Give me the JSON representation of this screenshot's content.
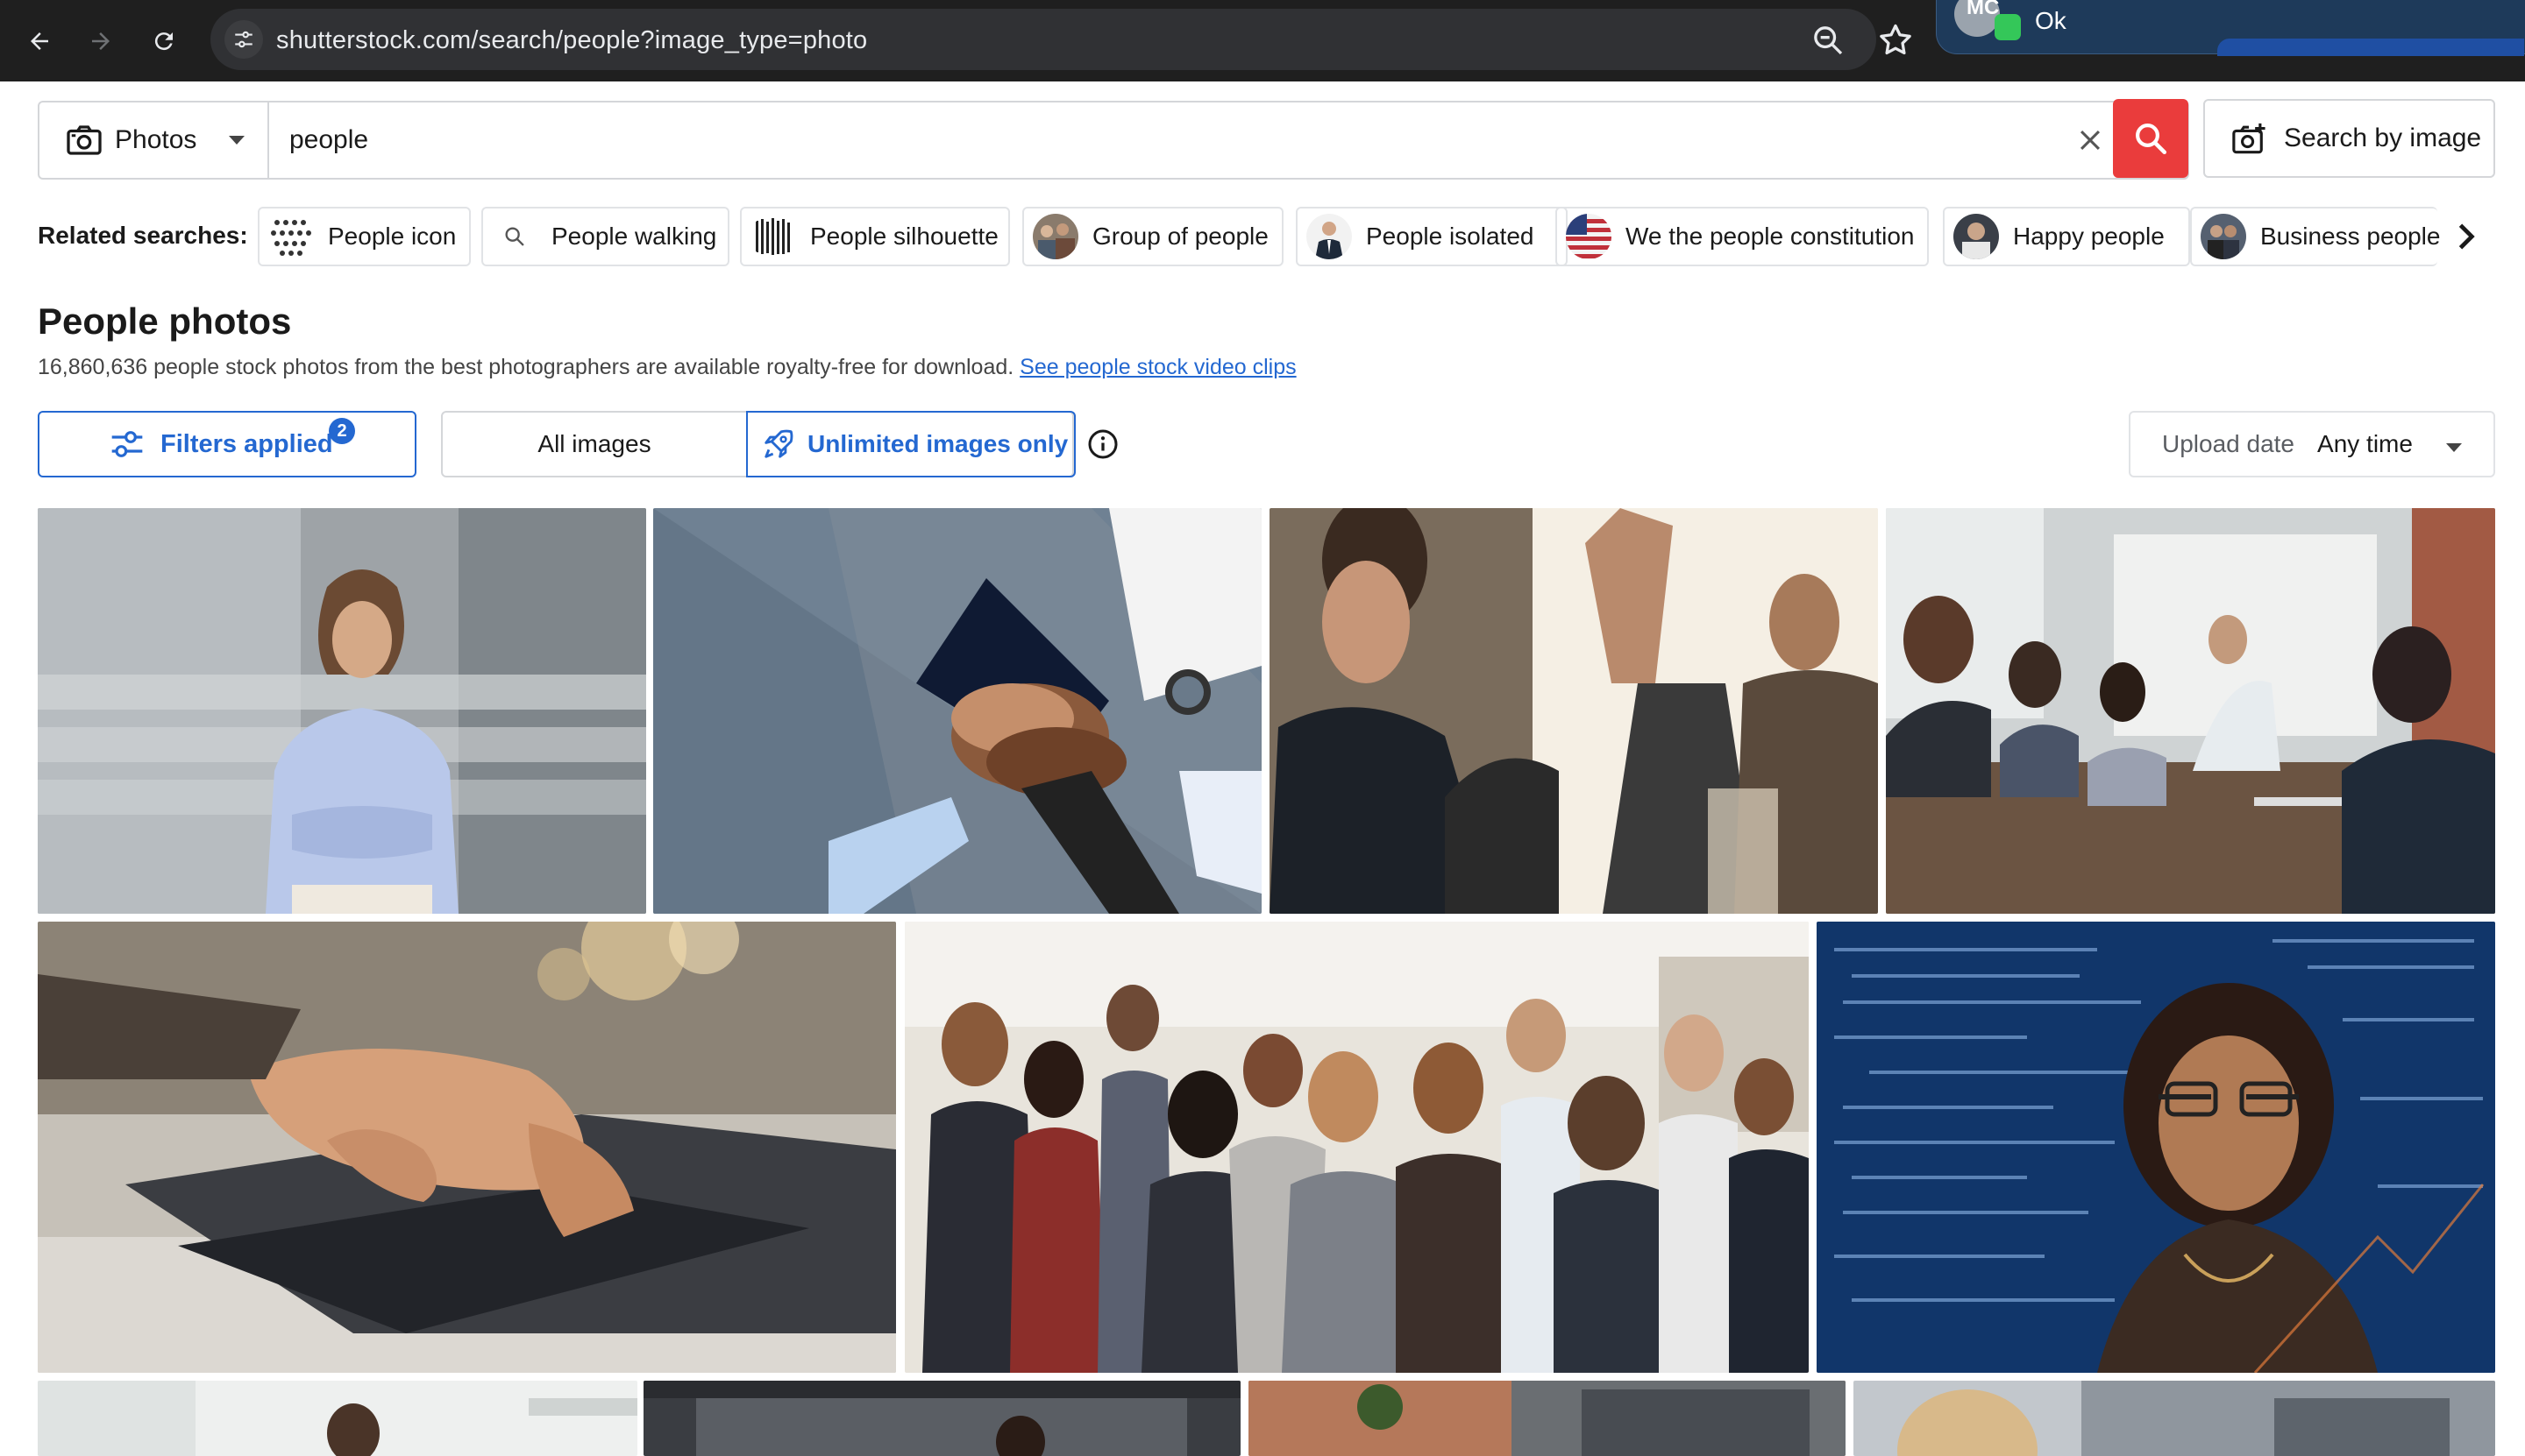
{
  "browser": {
    "url": "shutterstock.com/search/people?image_type=photo",
    "notification": {
      "initials": "MC",
      "message": "Ok"
    }
  },
  "search": {
    "type_label": "Photos",
    "query": "people",
    "search_by_image_label": "Search by image"
  },
  "related": {
    "label": "Related searches:",
    "items": [
      {
        "label": "People icon",
        "thumb": "icon-pattern"
      },
      {
        "label": "People walking",
        "thumb": "search-icon"
      },
      {
        "label": "People silhouette",
        "thumb": "silhouette-pattern"
      },
      {
        "label": "Group of people",
        "thumb": "photo"
      },
      {
        "label": "People isolated",
        "thumb": "photo"
      },
      {
        "label": "We the people constitution",
        "thumb": "flag-photo"
      },
      {
        "label": "Happy people",
        "thumb": "photo"
      },
      {
        "label": "Business people",
        "thumb": "photo"
      }
    ]
  },
  "heading": {
    "title": "People photos",
    "subtitle": "16,860,636 people stock photos from the best photographers are available royalty-free for download.",
    "link": "See people stock video clips"
  },
  "filters": {
    "filters_label": "Filters applied",
    "filters_count": "2",
    "all_images": "All images",
    "unlimited": "Unlimited images only",
    "upload_date_label": "Upload date",
    "upload_date_value": "Any time"
  },
  "results": [
    {
      "subject": "woman with crossed arms in office"
    },
    {
      "subject": "stacked hands teamwork"
    },
    {
      "subject": "group high five"
    },
    {
      "subject": "meeting around table"
    },
    {
      "subject": "hands typing on laptop"
    },
    {
      "subject": "crowd at business event"
    },
    {
      "subject": "woman with glasses and code overlay"
    },
    {
      "subject": "office photo"
    },
    {
      "subject": "office photo"
    },
    {
      "subject": "office photo"
    },
    {
      "subject": "office photo"
    }
  ],
  "colors": {
    "accent_blue": "#2468d1",
    "search_red": "#ea3c3c"
  }
}
